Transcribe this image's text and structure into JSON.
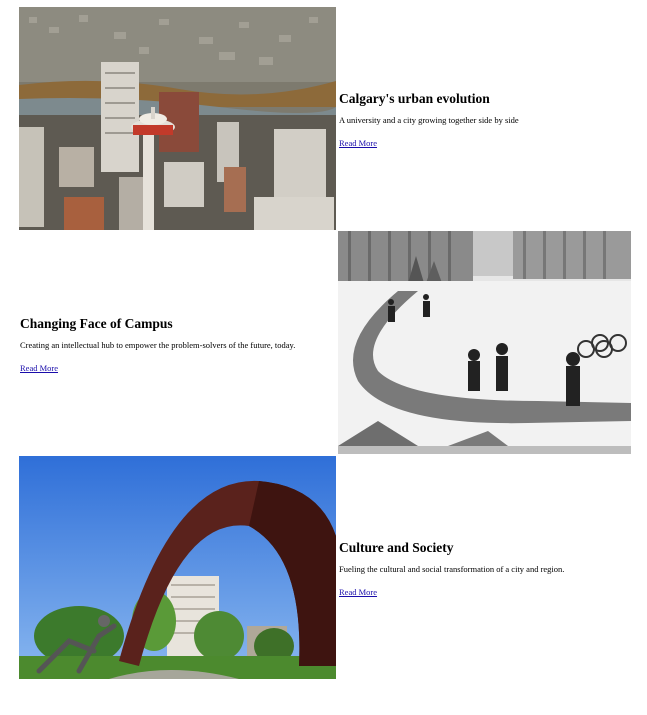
{
  "cards": [
    {
      "title": "Calgary's urban evolution",
      "description": "A university and a city growing together side by side",
      "link": "Read More"
    },
    {
      "title": "Changing Face of Campus",
      "description": "Creating an intellectual hub to empower the problem-solvers of the future, today.",
      "link": "Read More"
    },
    {
      "title": "Culture and Society",
      "description": "Fueling the cultural and social transformation of a city and region.",
      "link": "Read More"
    }
  ]
}
